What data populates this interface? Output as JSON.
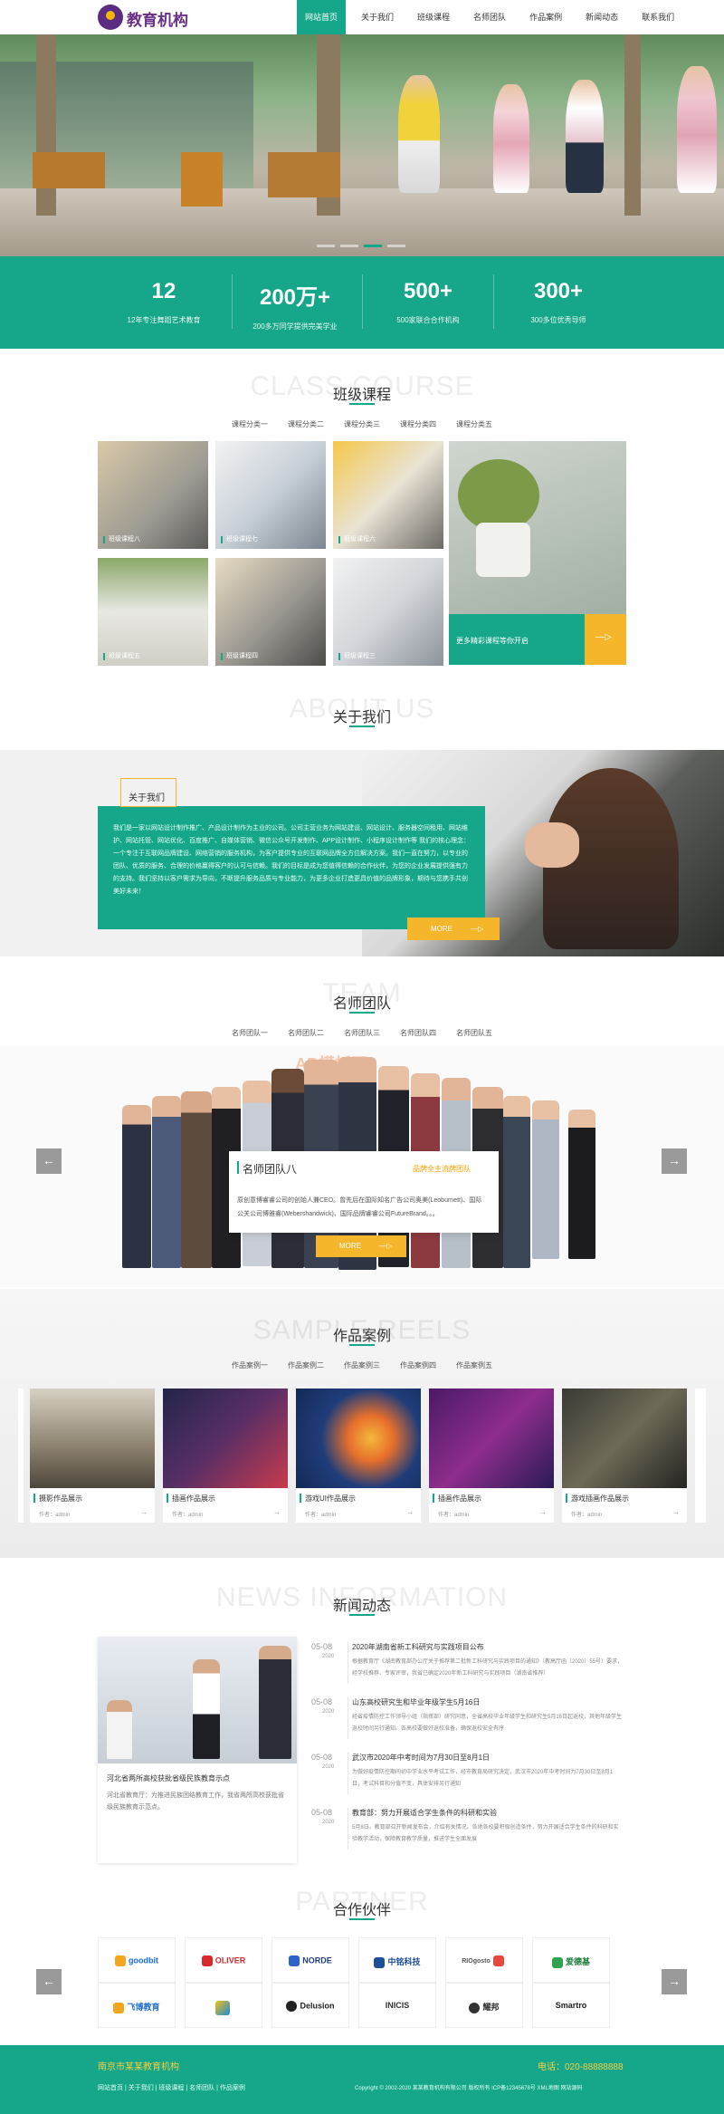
{
  "header": {
    "logo_text": "教育机构",
    "nav": [
      "网站首页",
      "关于我们",
      "班级课程",
      "名师团队",
      "作品案例",
      "新闻动态",
      "联系我们"
    ]
  },
  "stats": [
    {
      "num": "12",
      "desc": "12年专注舞蹈艺术教育"
    },
    {
      "num": "200万+",
      "desc": "200多万同学提供完美学业"
    },
    {
      "num": "500+",
      "desc": "500家联合合作机构"
    },
    {
      "num": "300+",
      "desc": "300多位优秀导师"
    }
  ],
  "courses": {
    "bg_title": "CLASS COURSE",
    "title": "班级课程",
    "tabs": [
      "课程分类一",
      "课程分类二",
      "课程分类三",
      "课程分类四",
      "课程分类五"
    ],
    "items": [
      "班级课程八",
      "班级课程七",
      "班级课程六",
      "班级课程五",
      "班级课程四",
      "班级课程三"
    ],
    "more_text": "更多精彩课程等你开启"
  },
  "about": {
    "bg_title": "ABOUT US",
    "title": "关于我们",
    "label": "关于我们",
    "text": "我们是一家以网站设计制作推广、产品设计制作为主业的公司。公司主营业务为网站建设、网站设计、服务器空间租用、网站维护、网站托管、网站优化、百度推广、自媒体营销、微信公众号开发制作、APP设计制作、小程序设计制作等 我们的核心理念：一个专注于互联网品牌建设、网络营销的服务机构，为客户提供专业的互联网品牌全方位解决方案。我们一直在努力，以专业的团队、优质的服务、合理的价格赢得客户的认可与信赖。我们的目标是成为您值得信赖的合作伙伴，为您的企业发展提供强有力的支持。我们坚持以客户需求为导向，不断提升服务品质与专业能力，为更多企业打造更具价值的品牌形象，期待与您携手共创美好未来！",
    "more": "MORE"
  },
  "team": {
    "bg_title": "TEAM",
    "title": "名师团队",
    "tabs": [
      "名师团队一",
      "名师团队二",
      "名师团队三",
      "名师团队四",
      "名师团队五"
    ],
    "name": "名师团队八",
    "tag": "品牌全主流牌团队",
    "desc": "原创意博睿睿公司的创始人兼CEO。曾先后在国际知名广告公司奥美(Leoburnett)、国际公关公司博雅睿(Webershandwick)、国际品牌睿睿公司FutureBrand。。。",
    "more": "MORE",
    "watermark": "AB模板网"
  },
  "works": {
    "bg_title": "SAMPLE REELS",
    "title": "作品案例",
    "tabs": [
      "作品案例一",
      "作品案例二",
      "作品案例三",
      "作品案例四",
      "作品案例五"
    ],
    "items": [
      {
        "title": "摄影作品展示",
        "author": "作者：admin"
      },
      {
        "title": "插画作品展示",
        "author": "作者：admin"
      },
      {
        "title": "游戏UI作品展示",
        "author": "作者：admin"
      },
      {
        "title": "插画作品展示",
        "author": "作者：admin"
      },
      {
        "title": "游戏插画作品展示",
        "author": "作者：admin"
      }
    ]
  },
  "news": {
    "bg_title": "NEWS INFORMATION",
    "title": "新闻动态",
    "feature_title": "河北省两所高校获批省级民族教育示点",
    "feature_desc": "河北省教育厅：为推进民族团结教育工作，我省两所高校获批省级民族教育示范点。",
    "items": [
      {
        "day": "05-08",
        "year": "2020",
        "title": "2020年湖南省新工科研究与实践项目公布",
        "summary": "根据教育厅《湖南教育部办公厅关于推荐第二批新工科研究与实践项目的通知》（教高厅函〔2020〕55号）要求，经学校推荐、专家评审，我省已确定2020年新工科研究与实践项目（湖南省推荐）"
      },
      {
        "day": "05-08",
        "year": "2020",
        "title": "山东高校研究生和毕业年级学生5月16日",
        "summary": "经省疫情防控工作领导小组（指挥部）研究同意，全省高校毕业年级学生和研究生5月16日起返校，其他年级学生返校时间另行通知。各高校要做好返校准备，确保返校安全有序"
      },
      {
        "day": "05-08",
        "year": "2020",
        "title": "武汉市2020年中考时间为7月30日至8月1日",
        "summary": "为做好疫情防控期间初中学业水平考试工作，经市教育局研究决定，武汉市2020年中考时间为7月30日至8月1日，考试科目和分值不变，具体安排另行通知"
      },
      {
        "day": "05-08",
        "year": "2020",
        "title": "教育部：努力开展适合学生条件的科研和实验",
        "summary": "5月8日，教育部召开新闻发布会，介绍有关情况。各地各校要积极创造条件，努力开展适合学生条件的科研和实验教学活动，保障教育教学质量，推进学生全面发展"
      }
    ]
  },
  "partners": {
    "bg_title": "PARTNER",
    "title": "合作伙伴",
    "items": [
      "goodbit",
      "OLIVER",
      "NORDE",
      "中铭科技",
      "RIOgosto",
      "爱德基",
      "飞博教育",
      "",
      "Delusion",
      "INICIS",
      "耀邦",
      "Smartro"
    ]
  },
  "footer": {
    "company": "南京市某某教育机构",
    "phone": "电话：020-88888888",
    "links": "网站首页 | 关于我们 | 班级课程 | 名师团队 | 作品案例",
    "copyright": "Copyright © 2002-2020 某某教育机构有限公司 版权所有 ICP备12345678号 XML地图 网站源码"
  },
  "colors": {
    "brand": "#16a68a",
    "accent": "#f6b62c",
    "logo": "#6b2f8a"
  }
}
